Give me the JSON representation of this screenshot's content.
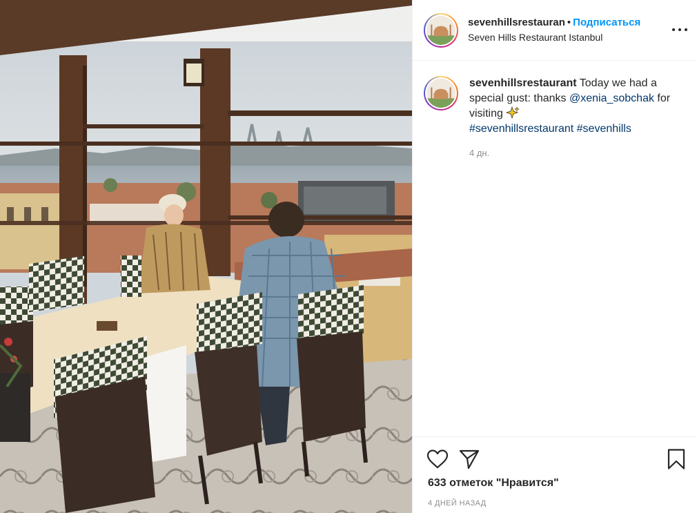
{
  "post": {
    "media_description_icon": "photo",
    "header": {
      "username": "sevenhillsrestauran",
      "separator": "•",
      "follow_label": "Подписаться",
      "location": "Seven Hills Restaurant Istanbul",
      "more_icon": "more-horizontal-icon"
    },
    "caption": {
      "username": "sevenhillsrestaurant",
      "text_start": "Today we had a special gust: thanks",
      "mention": "@xenia_sobchak",
      "text_end": "for visiting",
      "emoji_icon": "sparkles-icon",
      "hashtag_1": "#sevenhillsrestaurant",
      "hashtag_2": "#sevenhills",
      "time": "4 дн."
    },
    "actions": {
      "like_icon": "heart-icon",
      "share_icon": "send-icon",
      "save_icon": "bookmark-icon",
      "likes_text": "633 отметок \"Нравится\"",
      "timestamp": "4 дней назад"
    }
  },
  "colors": {
    "link_blue": "#0095f6",
    "mention_dark_blue": "#00376b",
    "muted_gray": "#8e8e8e",
    "text_dark": "#262626"
  }
}
